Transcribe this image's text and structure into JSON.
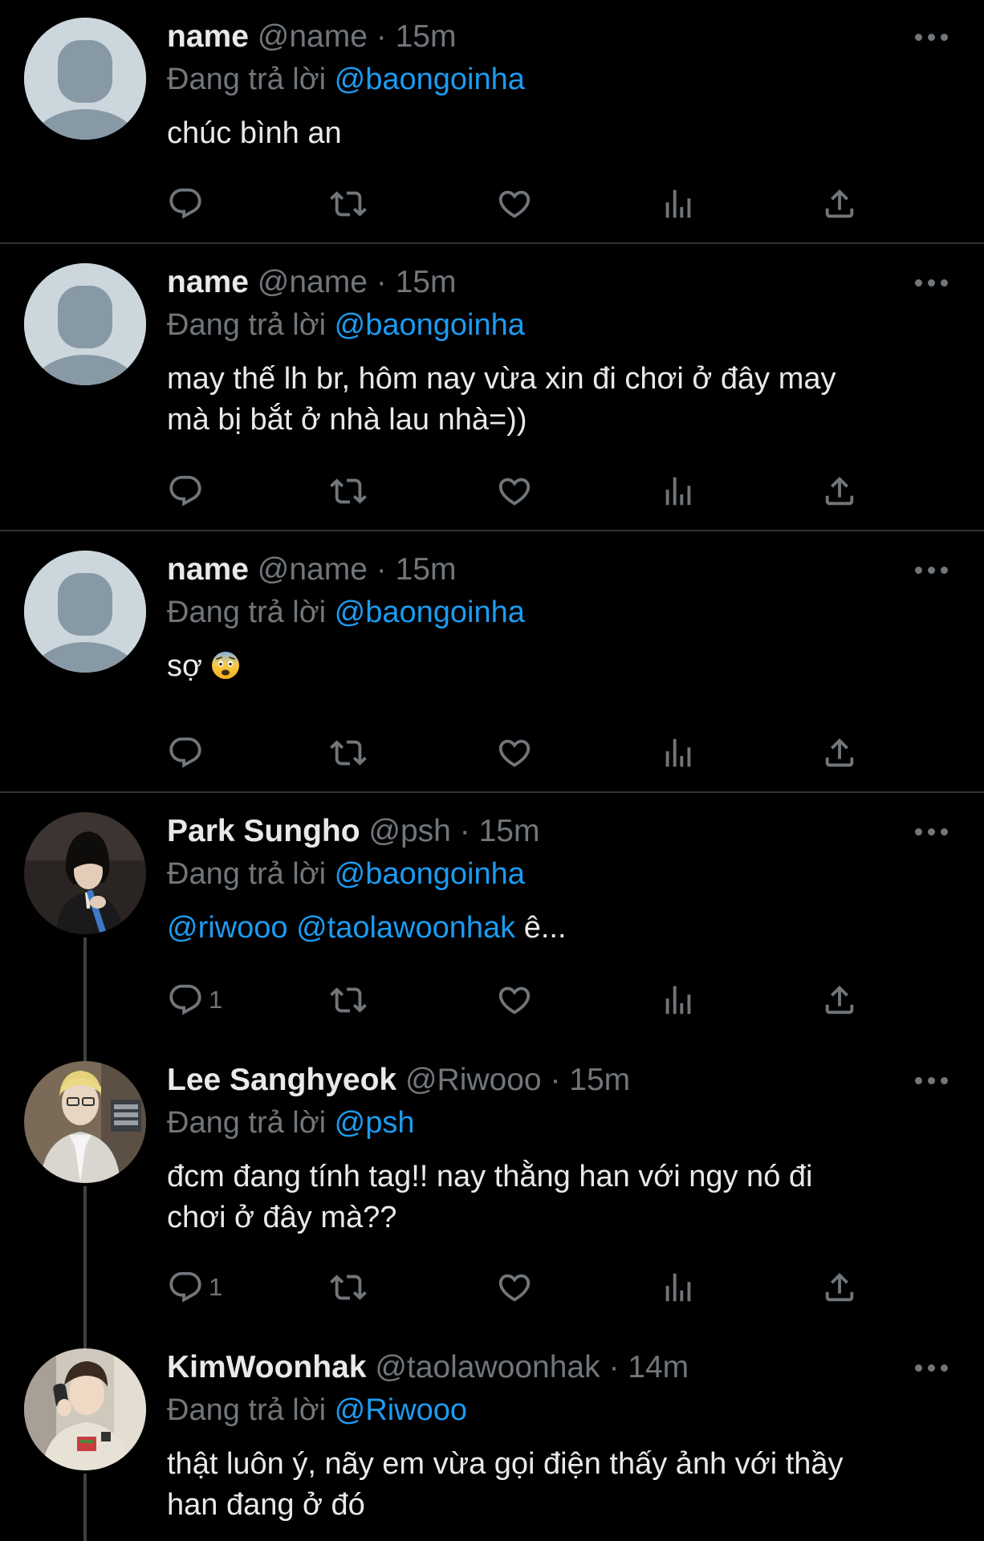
{
  "tweets": [
    {
      "name": "name",
      "handle": "@name",
      "dot": "·",
      "time": "15m",
      "reply_prefix": "Đang trả lời",
      "reply_mention": "@baongoinha",
      "text_lines": [
        "chúc bình an"
      ],
      "reply_count": ""
    },
    {
      "name": "name",
      "handle": "@name",
      "dot": "·",
      "time": "15m",
      "reply_prefix": "Đang trả lời",
      "reply_mention": "@baongoinha",
      "text_lines": [
        "may thế lh br, hôm nay vừa xin đi chơi ở đây may",
        "mà bị bắt ở nhà lau nhà=))"
      ],
      "reply_count": ""
    },
    {
      "name": "name",
      "handle": "@name",
      "dot": "·",
      "time": "15m",
      "reply_prefix": "Đang trả lời",
      "reply_mention": "@baongoinha",
      "text": "sợ",
      "emoji": "fearful-face",
      "reply_count": ""
    },
    {
      "name": "Park Sungho",
      "handle": "@psh",
      "dot": "·",
      "time": "15m",
      "reply_prefix": "Đang trả lời",
      "reply_mention": "@baongoinha",
      "mention_1": "@riwooo",
      "mention_2": "@taolawoonhak",
      "text_tail": "ê...",
      "reply_count": "1"
    },
    {
      "name": "Lee Sanghyeok",
      "handle": "@Riwooo",
      "dot": "·",
      "time": "15m",
      "reply_prefix": "Đang trả lời",
      "reply_mention": "@psh",
      "text_lines": [
        "đcm đang tính tag!! nay thằng han với ngy nó đi",
        "chơi ở đây mà??"
      ],
      "reply_count": "1"
    },
    {
      "name": "KimWoonhak",
      "handle": "@taolawoonhak",
      "dot": "·",
      "time": "14m",
      "reply_prefix": "Đang trả lời",
      "reply_mention": "@Riwooo",
      "text_lines": [
        "thật luôn ý, nãy em vừa gọi điện thấy ảnh với thầy",
        "han đang ở đó"
      ],
      "reply_count": ""
    }
  ],
  "icons": {
    "reply": "reply-icon",
    "retweet": "retweet-icon",
    "like": "heart-icon",
    "views": "views-icon",
    "share": "share-icon",
    "more": "more-icon"
  },
  "colors": {
    "background": "#000000",
    "text": "#e7e9ea",
    "secondary": "#71767b",
    "link": "#1d9bf0",
    "divider": "#2f3336"
  }
}
